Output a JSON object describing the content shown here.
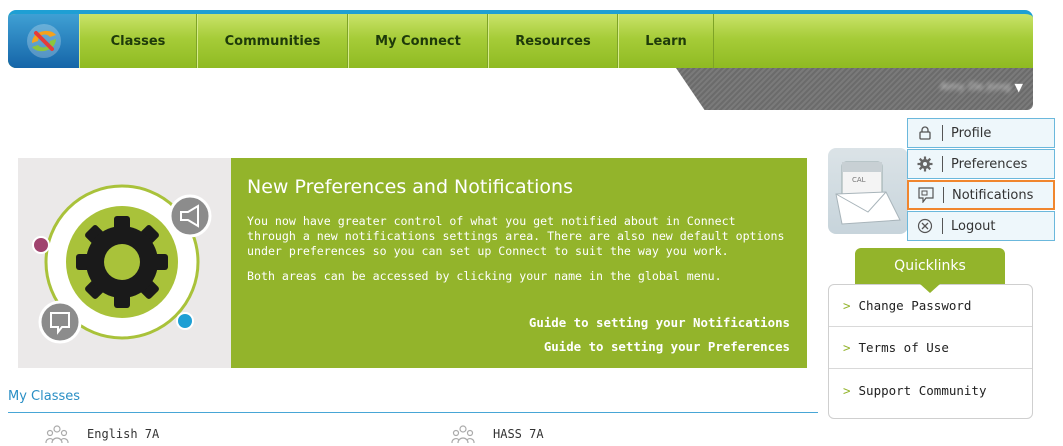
{
  "nav": {
    "logo_icon": "connect-logo-icon",
    "items": [
      {
        "label": "Classes"
      },
      {
        "label": "Communities"
      },
      {
        "label": "My Connect"
      },
      {
        "label": "Resources"
      },
      {
        "label": "Learn"
      }
    ]
  },
  "user": {
    "name": "Amy De Jong",
    "caret": "▼"
  },
  "user_menu": {
    "items": [
      {
        "label": "Profile",
        "icon": "lock-icon"
      },
      {
        "label": "Preferences",
        "icon": "gear-icon"
      },
      {
        "label": "Notifications",
        "icon": "speech-bubble-icon"
      },
      {
        "label": "Logout",
        "icon": "close-circle-icon"
      }
    ]
  },
  "banner": {
    "title": "New Preferences and Notifications",
    "para1": "You now have greater control of what you get notified about in Connect through a new notifications settings area. There are also new default options under preferences so you can set up Connect to suit the way you work.",
    "para2": "Both areas can be accessed by clicking your name in the global menu.",
    "link1": "Guide to setting your Notifications",
    "link2": "Guide to setting your Preferences"
  },
  "quicklinks": {
    "title": "Quicklinks",
    "items": [
      {
        "label": "Change Password"
      },
      {
        "label": "Terms of Use"
      },
      {
        "label": "Support Community"
      }
    ]
  },
  "my_classes": {
    "title": "My Classes",
    "items": [
      {
        "label": "English 7A"
      },
      {
        "label": "HASS 7A"
      }
    ]
  },
  "colors": {
    "nav_green": "#a6cc38",
    "banner_green": "#93b42b",
    "accent_blue": "#2a8fc5",
    "highlight_orange": "#f0862e"
  }
}
